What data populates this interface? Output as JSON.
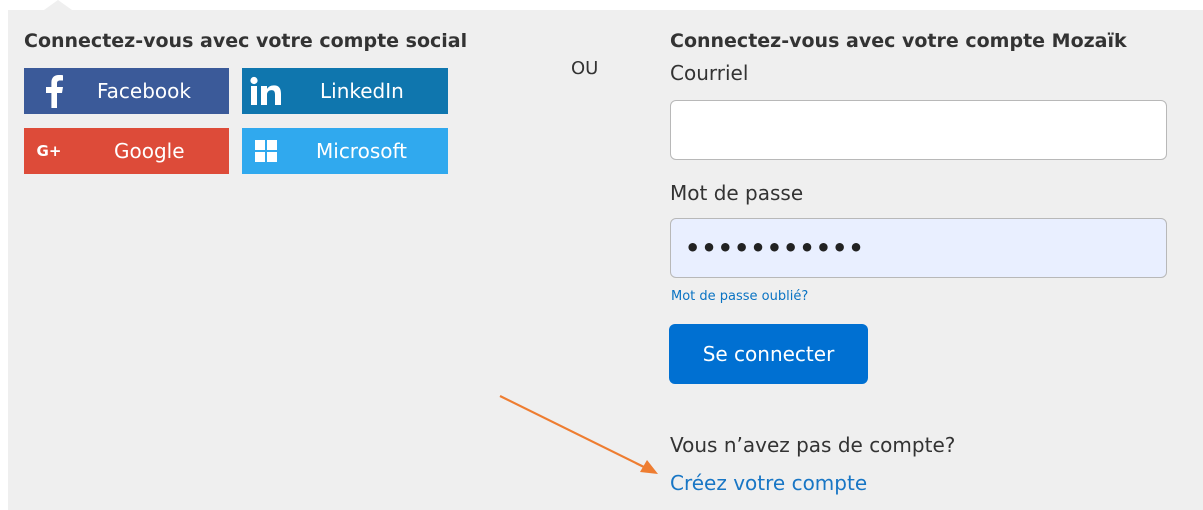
{
  "social": {
    "title": "Connectez-vous avec votre compte social",
    "buttons": {
      "facebook": {
        "label": "Facebook",
        "icon": "facebook-icon",
        "color": "#3b5a99"
      },
      "linkedin": {
        "label": "LinkedIn",
        "icon": "linkedin-icon",
        "color": "#0f76ae"
      },
      "google": {
        "label": "Google",
        "icon": "google-plus-icon",
        "color": "#dd4b39"
      },
      "microsoft": {
        "label": "Microsoft",
        "icon": "windows-icon",
        "color": "#30a9ee"
      }
    }
  },
  "separator": "OU",
  "mozaik": {
    "title": "Connectez-vous avec votre compte Mozaïk",
    "email_label": "Courriel",
    "email_value": "",
    "password_label": "Mot de passe",
    "password_value": "•••••••••••",
    "forgot_link": "Mot de passe oublié?",
    "login_button": "Se connecter",
    "no_account_text": "Vous n’avez pas de compte?",
    "create_link": "Créez votre compte"
  },
  "annotation": {
    "arrow_color": "#ee7d31"
  }
}
